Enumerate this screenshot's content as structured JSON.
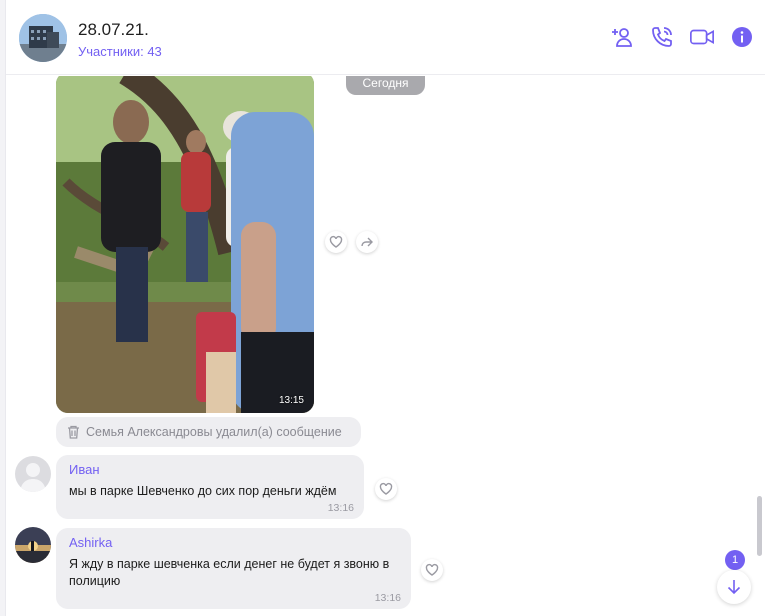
{
  "header": {
    "title": "28.07.21.",
    "members": "Участники: 43",
    "icons": [
      "add-participant-icon",
      "phone-call-icon",
      "video-call-icon",
      "info-icon"
    ]
  },
  "photo_message": {
    "time": "13:15"
  },
  "date_separator": "Сегодня",
  "deleted_notice": "Семья Александровы удалил(а) сообщение",
  "messages": [
    {
      "sender": "Иван",
      "text": "мы в парке Шевченко до сих пор деньги ждём",
      "time": "13:16"
    },
    {
      "sender": "Ashirka",
      "text": "Я жду в парке шевченка если денег не будет я звоню в полицию",
      "time": "13:16"
    }
  ],
  "unread_count": "1",
  "colors": {
    "accent": "#7360f2",
    "bubble": "#eeeef1",
    "date_pill": "#a9a9ad"
  }
}
